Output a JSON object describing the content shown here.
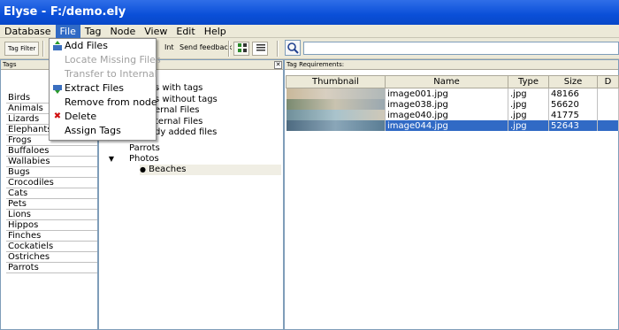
{
  "window": {
    "title": "Elyse - F:/demo.ely"
  },
  "menubar": {
    "items": [
      "Database",
      "File",
      "Tag",
      "Node",
      "View",
      "Edit",
      "Help"
    ]
  },
  "toolbar": {
    "tag_filter": "Tag Filter",
    "int_label": "Int",
    "send_feedback": "Send feedback"
  },
  "file_menu": {
    "items": [
      {
        "label": "Add Files",
        "enabled": true,
        "icon": "add-files-icon"
      },
      {
        "label": "Locate Missing Files",
        "enabled": false
      },
      {
        "label": "Transfer to Internal",
        "enabled": false
      },
      {
        "label": "Extract Files",
        "enabled": true,
        "icon": "extract-files-icon"
      },
      {
        "label": "Remove from node",
        "enabled": true
      },
      {
        "label": "Delete",
        "enabled": true,
        "icon": "delete-x-icon"
      },
      {
        "label": "Assign Tags",
        "enabled": true
      }
    ]
  },
  "tags_panel": {
    "title": "Tags",
    "tags": [
      "Birds",
      "Animals",
      "Lizards",
      "Elephants",
      "Frogs",
      "Buffaloes",
      "Wallabies",
      "Bugs",
      "Crocodiles",
      "Cats",
      "Pets",
      "Lions",
      "Hippos",
      "Finches",
      "Cockatiels",
      "Ostriches",
      "Parrots"
    ]
  },
  "tree_panel": {
    "partial_items": [
      "s with tags",
      "s without tags",
      "ernal Files",
      "ternal Files",
      "dy added files"
    ],
    "items": [
      {
        "label": "Birds",
        "expander": "▷"
      },
      {
        "label": "Parrots",
        "expander": ""
      },
      {
        "label": "Photos",
        "expander": "▼"
      },
      {
        "label": "Beaches",
        "expander": "●"
      }
    ]
  },
  "files_panel": {
    "title": "Tag Requirements:",
    "columns": [
      "Thumbnail",
      "Name",
      "Type",
      "Size",
      "D"
    ],
    "rows": [
      {
        "name": "image001.jpg",
        "type": ".jpg",
        "size": "48166",
        "selected": false
      },
      {
        "name": "image038.jpg",
        "type": ".jpg",
        "size": "56620",
        "selected": false
      },
      {
        "name": "image040.jpg",
        "type": ".jpg",
        "size": "41775",
        "selected": false
      },
      {
        "name": "image044.jpg",
        "type": ".jpg",
        "size": "52643",
        "selected": true
      }
    ]
  }
}
